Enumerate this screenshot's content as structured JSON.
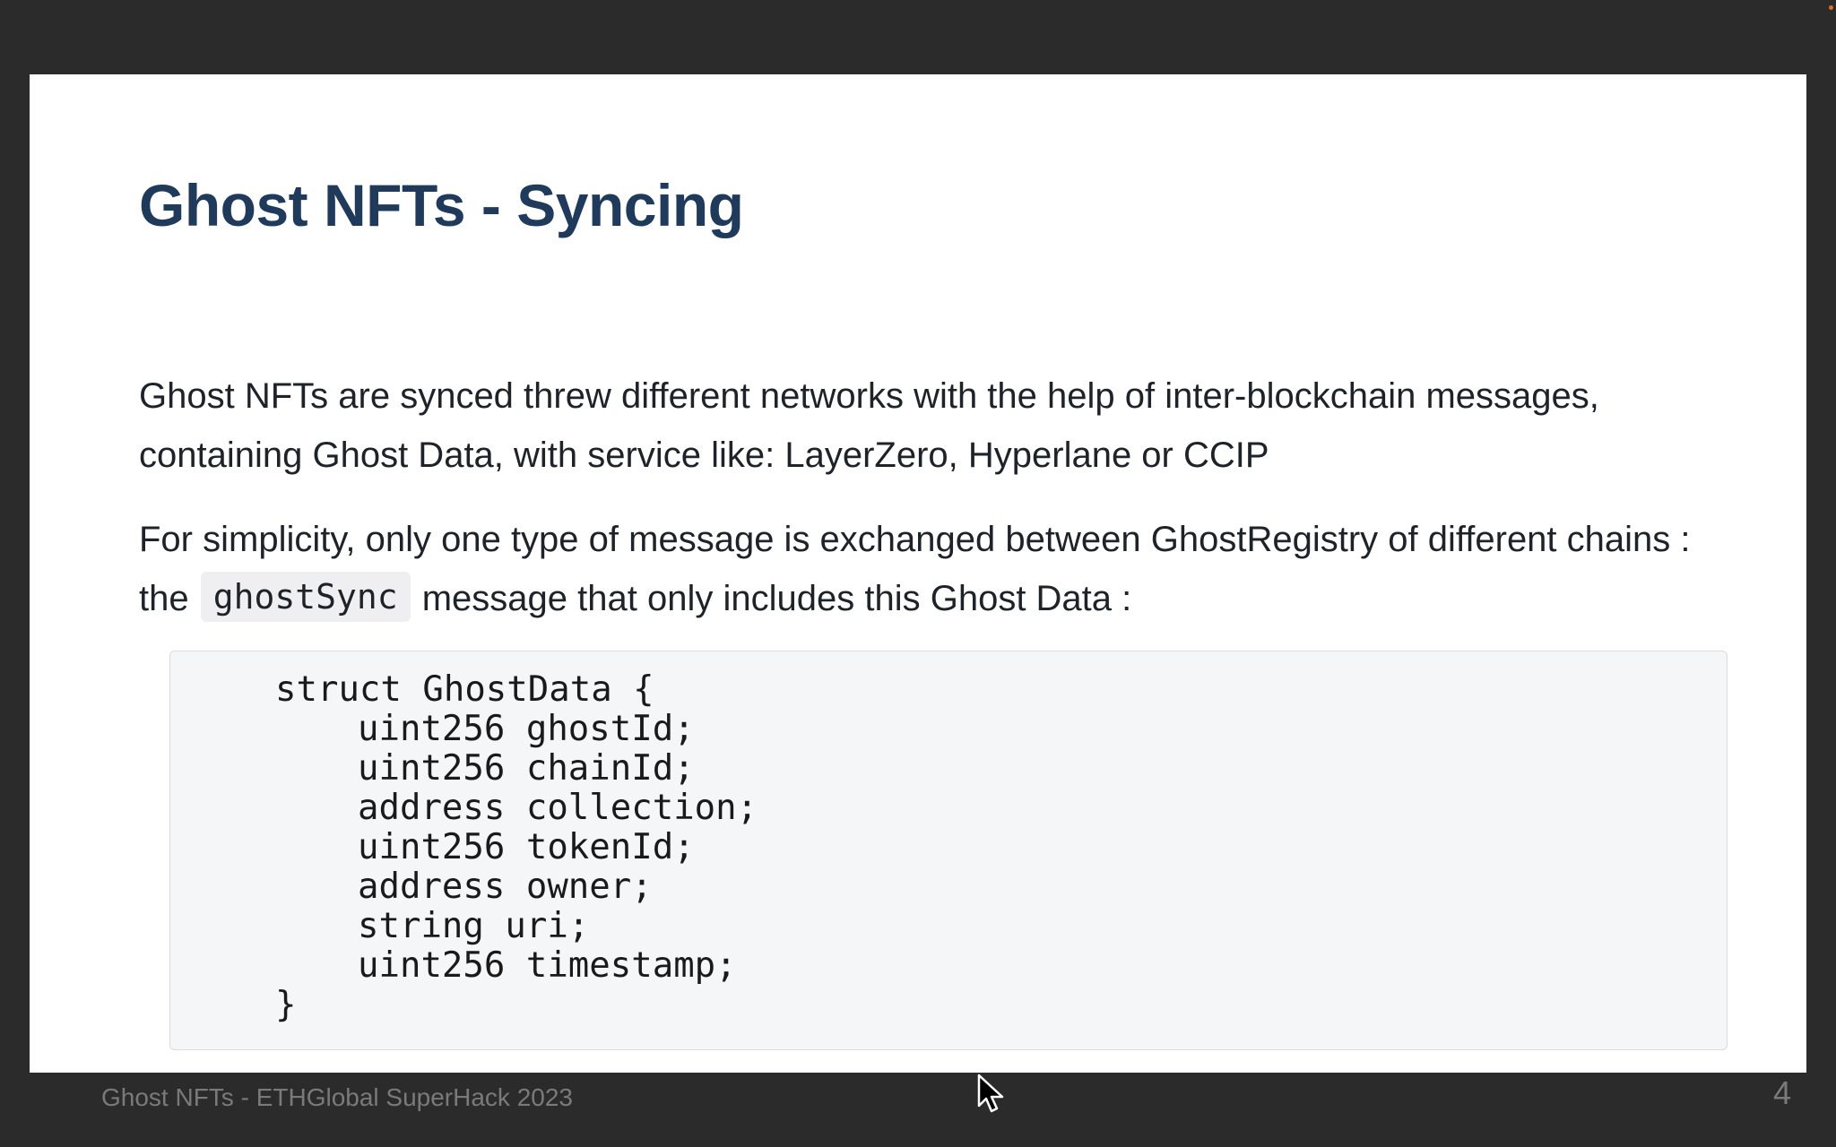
{
  "slide": {
    "title": "Ghost NFTs - Syncing",
    "paragraph1": "Ghost NFTs are synced threw different networks with the help of inter-blockchain messages, containing Ghost Data, with service like: LayerZero, Hyperlane or CCIP",
    "paragraph2_before": "For simplicity, only one type of message is exchanged between GhostRegistry of different chains : the ",
    "paragraph2_code": "ghostSync",
    "paragraph2_after": " message that only includes this Ghost Data :",
    "code": {
      "open": "struct GhostData {",
      "fields": [
        "uint256 ghostId;",
        "uint256 chainId;",
        "address collection;",
        "uint256 tokenId;",
        "address owner;",
        "string uri;",
        "uint256 timestamp;"
      ],
      "close": "}"
    },
    "footer": "Ghost NFTs - ETHGlobal SuperHack 2023",
    "page_number": "4"
  },
  "colors": {
    "background": "#2b2b2b",
    "title": "#1f3a5a",
    "code_background": "#f5f6f8"
  },
  "icons": {
    "cursor": "mouse-pointer-icon"
  }
}
